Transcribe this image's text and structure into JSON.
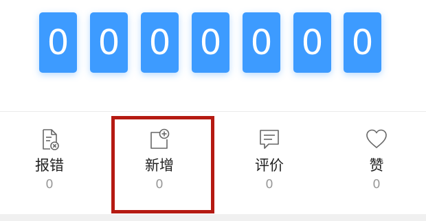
{
  "counter": {
    "digits": [
      "0",
      "0",
      "0",
      "0",
      "0",
      "0",
      "0"
    ],
    "color": "#3d9bff"
  },
  "actions": [
    {
      "label": "报错",
      "count": "0",
      "icon": "report-error-icon"
    },
    {
      "label": "新增",
      "count": "0",
      "icon": "add-new-icon"
    },
    {
      "label": "评价",
      "count": "0",
      "icon": "comment-icon"
    },
    {
      "label": "赞",
      "count": "0",
      "icon": "heart-icon"
    }
  ],
  "highlight": {
    "color": "#b51a12",
    "target": "新增"
  }
}
